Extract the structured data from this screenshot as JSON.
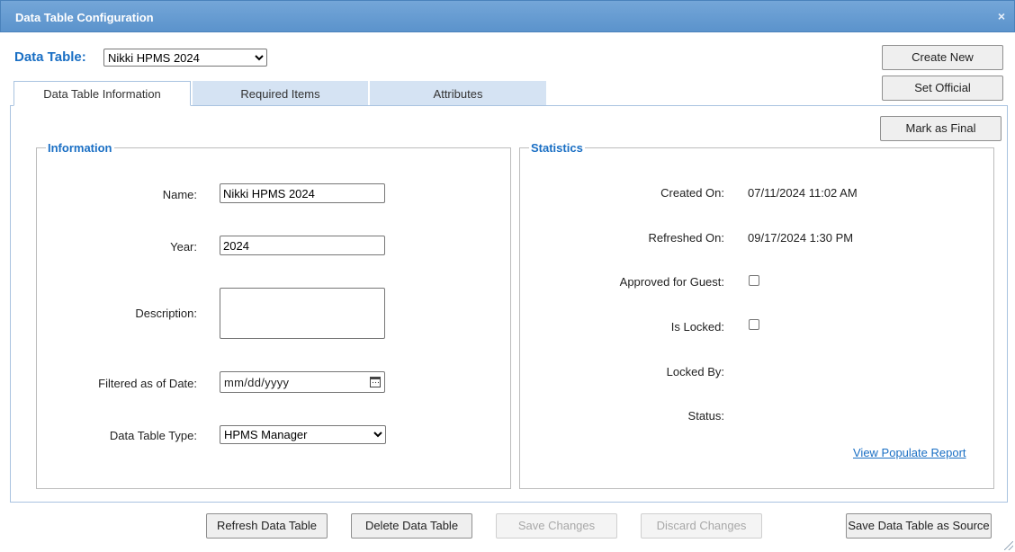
{
  "window": {
    "title": "Data Table Configuration",
    "close_glyph": "×"
  },
  "data_table": {
    "label": "Data Table:",
    "selected": "Nikki HPMS 2024"
  },
  "actions": {
    "create_new": "Create New",
    "set_official": "Set Official",
    "mark_as_final": "Mark as Final"
  },
  "tabs": [
    {
      "label": "Data Table Information",
      "active": true
    },
    {
      "label": "Required Items",
      "active": false
    },
    {
      "label": "Attributes",
      "active": false
    }
  ],
  "information": {
    "legend": "Information",
    "name_label": "Name:",
    "name_value": "Nikki HPMS 2024",
    "year_label": "Year:",
    "year_value": "2024",
    "description_label": "Description:",
    "description_value": "",
    "filtered_label": "Filtered as of Date:",
    "filtered_placeholder": "mm/dd/yyyy",
    "type_label": "Data Table Type:",
    "type_value": "HPMS Manager"
  },
  "statistics": {
    "legend": "Statistics",
    "created_label": "Created On:",
    "created_value": "07/11/2024 11:02 AM",
    "refreshed_label": "Refreshed On:",
    "refreshed_value": "09/17/2024 1:30 PM",
    "approved_label": "Approved for Guest:",
    "approved_checked": false,
    "locked_label": "Is Locked:",
    "locked_checked": false,
    "locked_by_label": "Locked By:",
    "status_label": "Status:",
    "report_link": "View Populate Report"
  },
  "footer": {
    "refresh": "Refresh Data Table",
    "delete": "Delete Data Table",
    "save_changes": "Save Changes",
    "discard_changes": "Discard Changes",
    "save_as_source": "Save Data Table as Source"
  }
}
